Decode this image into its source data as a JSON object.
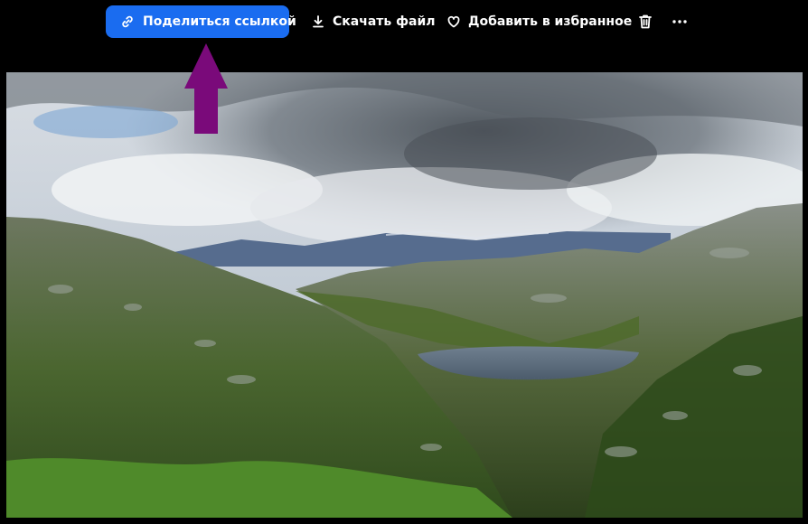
{
  "toolbar": {
    "share_label": "Поделиться ссылкой",
    "download_label": "Скачать файл",
    "favorite_label": "Добавить в избранное",
    "share_icon": "link-icon",
    "download_icon": "download-icon",
    "favorite_icon": "heart-icon",
    "delete_icon": "trash-icon",
    "more_icon": "more-horizontal-icon"
  },
  "colors": {
    "accent": "#1a6cf0",
    "background": "#000000",
    "annotation_arrow": "#7a0a7a"
  },
  "image": {
    "content": "mountain-valley-lake-landscape"
  }
}
